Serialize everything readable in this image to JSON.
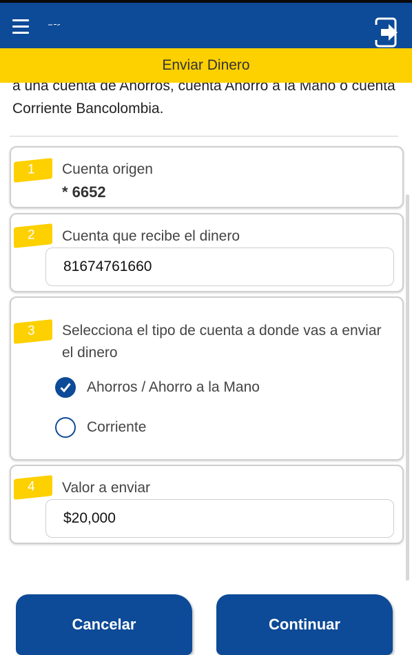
{
  "header": {
    "menu_icon": "menu-icon",
    "exit_icon": "logout-icon",
    "title": "Enviar Dinero",
    "bar_color": "#0d4a97",
    "accent_color": "#fdd000"
  },
  "intro": {
    "text": "a una cuenta de Ahorros, cuenta Ahorro a la Mano o cuenta Corriente Bancolombia."
  },
  "steps": [
    {
      "number": "1",
      "label": "Cuenta origen",
      "value": "* 6652"
    },
    {
      "number": "2",
      "label": "Cuenta que recibe el dinero",
      "input_value": "81674761660"
    },
    {
      "number": "3",
      "label": "Selecciona el tipo de cuenta a donde vas a enviar el dinero",
      "options": [
        {
          "label": "Ahorros / Ahorro a la Mano",
          "selected": true
        },
        {
          "label": "Corriente",
          "selected": false
        }
      ]
    },
    {
      "number": "4",
      "label": "Valor a enviar",
      "input_value": "$20,000"
    }
  ],
  "buttons": {
    "cancel_label": "Cancelar",
    "continue_label": "Continuar"
  }
}
